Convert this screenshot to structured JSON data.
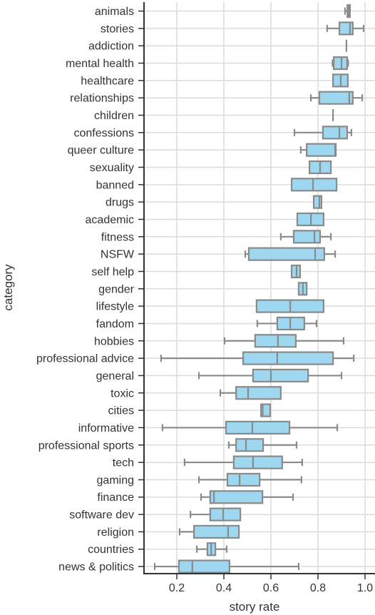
{
  "chart_data": {
    "type": "boxplot",
    "orientation": "horizontal",
    "title": "",
    "xlabel": "story rate",
    "ylabel": "category",
    "xlim": [
      0.06,
      1.04
    ],
    "xticks": [
      0.2,
      0.4,
      0.6,
      0.8,
      1.0
    ],
    "xtick_labels": [
      "0.2",
      "0.4",
      "0.6",
      "0.8",
      "1.0"
    ],
    "grid": true,
    "box_fill": "#9dd7f0",
    "line_color": "#8a8a8a",
    "categories": [
      "animals",
      "stories",
      "addiction",
      "mental health",
      "healthcare",
      "relationships",
      "children",
      "confessions",
      "queer culture",
      "sexuality",
      "banned",
      "drugs",
      "academic",
      "fitness",
      "NSFW",
      "self help",
      "gender",
      "lifestyle",
      "fandom",
      "hobbies",
      "professional advice",
      "general",
      "toxic",
      "cities",
      "informative",
      "professional sports",
      "tech",
      "gaming",
      "finance",
      "software dev",
      "religion",
      "countries",
      "news & politics"
    ],
    "series": [
      {
        "name": "animals",
        "whislo": 0.915,
        "q1": 0.925,
        "med": 0.93,
        "q3": 0.936,
        "whishi": 0.936
      },
      {
        "name": "stories",
        "whislo": 0.839,
        "q1": 0.891,
        "med": 0.936,
        "q3": 0.948,
        "whishi": 0.994
      },
      {
        "name": "addiction",
        "whislo": 0.921,
        "q1": 0.921,
        "med": 0.921,
        "q3": 0.921,
        "whishi": 0.921
      },
      {
        "name": "mental health",
        "whislo": 0.862,
        "q1": 0.867,
        "med": 0.9,
        "q3": 0.924,
        "whishi": 0.928
      },
      {
        "name": "healthcare",
        "whislo": 0.864,
        "q1": 0.864,
        "med": 0.897,
        "q3": 0.927,
        "whishi": 0.927
      },
      {
        "name": "relationships",
        "whislo": 0.77,
        "q1": 0.806,
        "med": 0.933,
        "q3": 0.948,
        "whishi": 0.988
      },
      {
        "name": "children",
        "whislo": 0.864,
        "q1": 0.864,
        "med": 0.864,
        "q3": 0.864,
        "whishi": 0.864
      },
      {
        "name": "confessions",
        "whislo": 0.7,
        "q1": 0.821,
        "med": 0.891,
        "q3": 0.924,
        "whishi": 0.942
      },
      {
        "name": "queer culture",
        "whislo": 0.727,
        "q1": 0.752,
        "med": 0.873,
        "q3": 0.876,
        "whishi": 0.876
      },
      {
        "name": "sexuality",
        "whislo": 0.764,
        "q1": 0.764,
        "med": 0.809,
        "q3": 0.855,
        "whishi": 0.855
      },
      {
        "name": "banned",
        "whislo": 0.688,
        "q1": 0.688,
        "med": 0.779,
        "q3": 0.879,
        "whishi": 0.879
      },
      {
        "name": "drugs",
        "whislo": 0.782,
        "q1": 0.782,
        "med": 0.806,
        "q3": 0.815,
        "whishi": 0.815
      },
      {
        "name": "academic",
        "whislo": 0.712,
        "q1": 0.712,
        "med": 0.77,
        "q3": 0.824,
        "whishi": 0.824
      },
      {
        "name": "fitness",
        "whislo": 0.642,
        "q1": 0.697,
        "med": 0.785,
        "q3": 0.809,
        "whishi": 0.855
      },
      {
        "name": "NSFW",
        "whislo": 0.491,
        "q1": 0.506,
        "med": 0.788,
        "q3": 0.827,
        "whishi": 0.873
      },
      {
        "name": "self help",
        "whislo": 0.688,
        "q1": 0.688,
        "med": 0.709,
        "q3": 0.724,
        "whishi": 0.724
      },
      {
        "name": "gender",
        "whislo": 0.718,
        "q1": 0.718,
        "med": 0.736,
        "q3": 0.752,
        "whishi": 0.752
      },
      {
        "name": "lifestyle",
        "whislo": 0.539,
        "q1": 0.539,
        "med": 0.682,
        "q3": 0.824,
        "whishi": 0.824
      },
      {
        "name": "fandom",
        "whislo": 0.542,
        "q1": 0.627,
        "med": 0.682,
        "q3": 0.742,
        "whishi": 0.794
      },
      {
        "name": "hobbies",
        "whislo": 0.403,
        "q1": 0.533,
        "med": 0.63,
        "q3": 0.706,
        "whishi": 0.909
      },
      {
        "name": "professional advice",
        "whislo": 0.133,
        "q1": 0.482,
        "med": 0.627,
        "q3": 0.864,
        "whishi": 0.952
      },
      {
        "name": "general",
        "whislo": 0.294,
        "q1": 0.524,
        "med": 0.6,
        "q3": 0.758,
        "whishi": 0.9
      },
      {
        "name": "toxic",
        "whislo": 0.385,
        "q1": 0.452,
        "med": 0.503,
        "q3": 0.642,
        "whishi": 0.642
      },
      {
        "name": "cities",
        "whislo": 0.558,
        "q1": 0.558,
        "med": 0.565,
        "q3": 0.597,
        "whishi": 0.597
      },
      {
        "name": "informative",
        "whislo": 0.139,
        "q1": 0.409,
        "med": 0.521,
        "q3": 0.679,
        "whishi": 0.882
      },
      {
        "name": "professional sports",
        "whislo": 0.421,
        "q1": 0.452,
        "med": 0.494,
        "q3": 0.567,
        "whishi": 0.709
      },
      {
        "name": "tech",
        "whislo": 0.233,
        "q1": 0.442,
        "med": 0.524,
        "q3": 0.648,
        "whishi": 0.733
      },
      {
        "name": "gaming",
        "whislo": 0.294,
        "q1": 0.415,
        "med": 0.467,
        "q3": 0.552,
        "whishi": 0.73
      },
      {
        "name": "finance",
        "whislo": 0.303,
        "q1": 0.342,
        "med": 0.358,
        "q3": 0.564,
        "whishi": 0.694
      },
      {
        "name": "software dev",
        "whislo": 0.258,
        "q1": 0.342,
        "med": 0.397,
        "q3": 0.47,
        "whishi": 0.47
      },
      {
        "name": "religion",
        "whislo": 0.212,
        "q1": 0.273,
        "med": 0.418,
        "q3": 0.464,
        "whishi": 0.464
      },
      {
        "name": "countries",
        "whislo": 0.285,
        "q1": 0.33,
        "med": 0.346,
        "q3": 0.364,
        "whishi": 0.412
      },
      {
        "name": "news & politics",
        "whislo": 0.106,
        "q1": 0.209,
        "med": 0.266,
        "q3": 0.424,
        "whishi": 0.718
      }
    ]
  }
}
